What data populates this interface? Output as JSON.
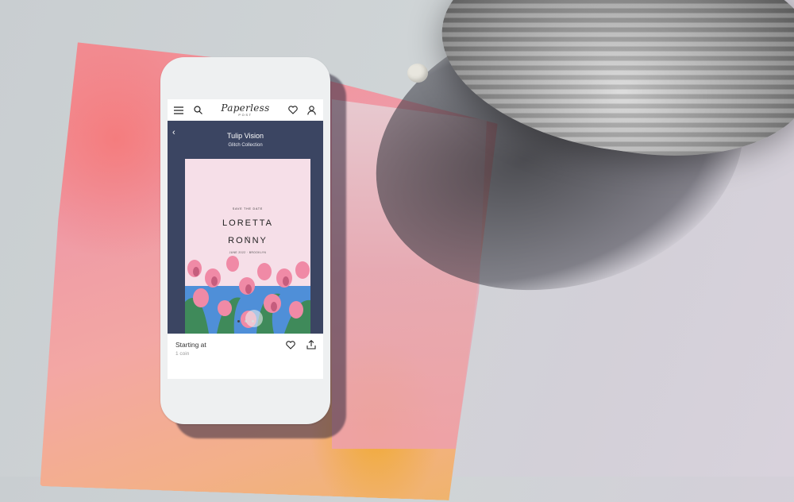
{
  "nav": {
    "logo_text": "Paperless",
    "logo_sub": "POST",
    "icons": [
      "menu-icon",
      "search-icon",
      "heart-icon",
      "account-icon"
    ]
  },
  "product": {
    "back_label": "‹",
    "title": "Tulip Vision",
    "collection": "Glitch Collection"
  },
  "card": {
    "save_the_date": "SAVE THE DATE",
    "name_1": "LORETTA",
    "amp": "&",
    "name_2": "RONNY",
    "details": "JUNE 2022 · BROOKLYN"
  },
  "carousel": {
    "total": 3,
    "active": 1
  },
  "pricing": {
    "label": "Starting at",
    "value": "1 coin"
  },
  "colors": {
    "header_navy": "#3b4562",
    "card_pink": "#f6dfe8",
    "phone_body": "#eef0f1"
  }
}
